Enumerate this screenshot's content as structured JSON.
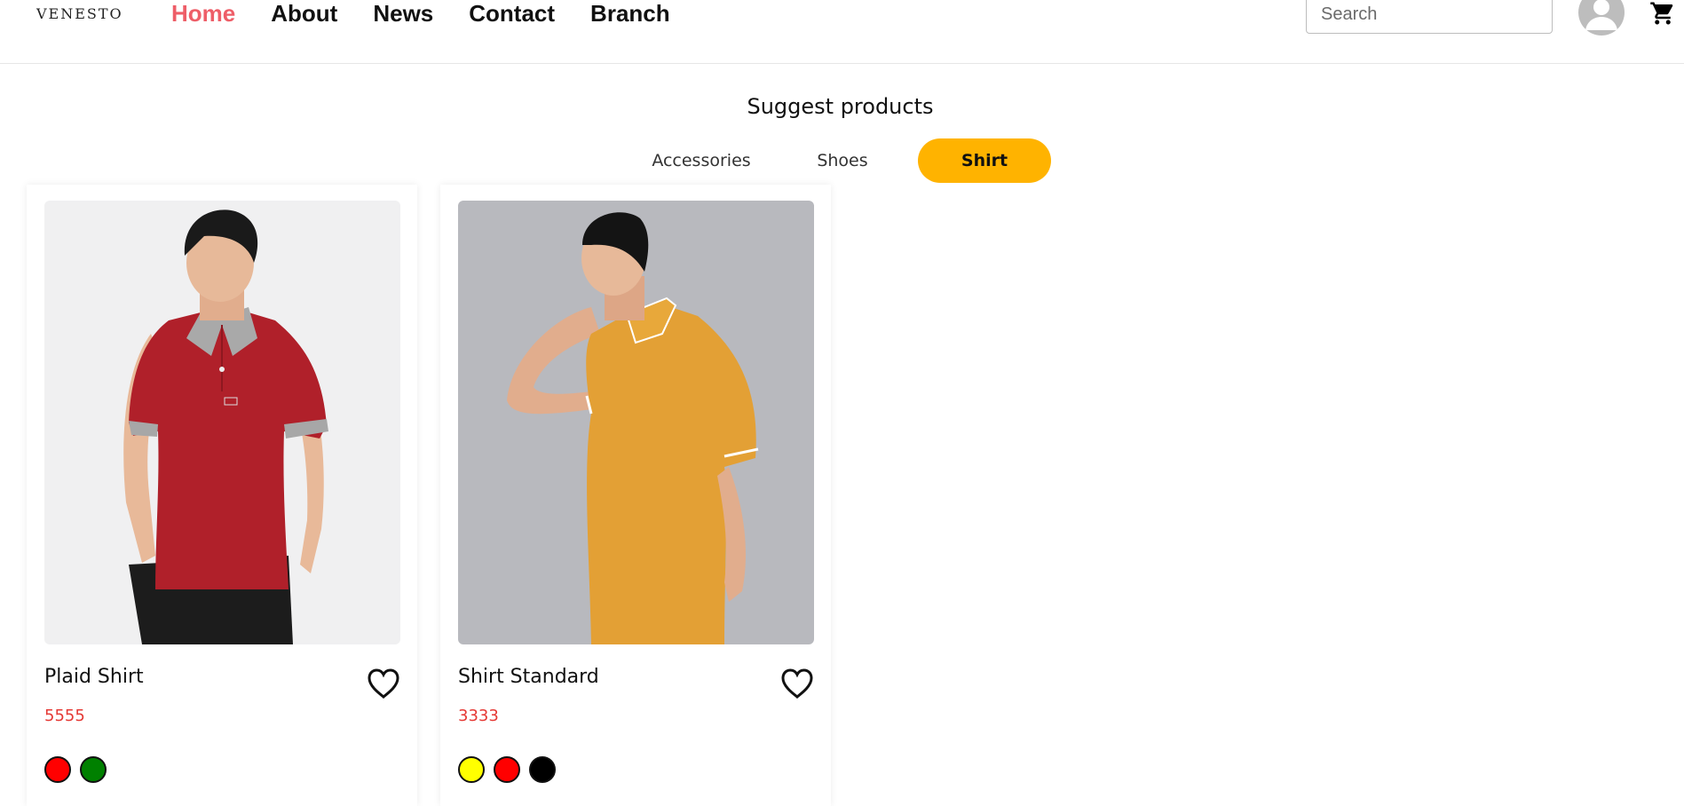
{
  "header": {
    "logo": "VENESTO",
    "nav": [
      {
        "label": "Home",
        "active": true
      },
      {
        "label": "About"
      },
      {
        "label": "News"
      },
      {
        "label": "Contact"
      },
      {
        "label": "Branch"
      }
    ],
    "search_placeholder": "Search",
    "icons": {
      "account": "account-circle-icon",
      "cart": "cart-icon"
    }
  },
  "section": {
    "title": "Suggest products",
    "tabs": [
      {
        "label": "Accessories",
        "active": false
      },
      {
        "label": "Shoes",
        "active": false
      },
      {
        "label": "Shirt",
        "active": true
      }
    ]
  },
  "products": [
    {
      "name": "Plaid Shirt",
      "price": "5555",
      "image": "man-red-polo-shirt",
      "colors": [
        "#ff0000",
        "#008000"
      ]
    },
    {
      "name": "Shirt Standard",
      "price": "3333",
      "image": "man-mustard-polo-shirt",
      "colors": [
        "#ffff00",
        "#ff0000",
        "#000000"
      ]
    }
  ],
  "colors": {
    "accent": "#ffb300",
    "active_nav": "#ee5e68",
    "price": "#e53935"
  }
}
